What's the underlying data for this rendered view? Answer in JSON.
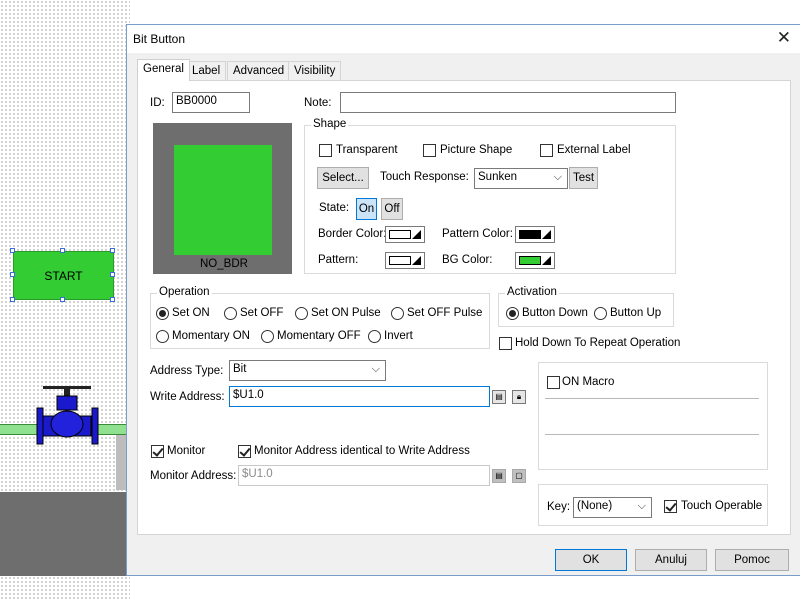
{
  "background": {
    "start_button_label": "START"
  },
  "dialog": {
    "title": "Bit Button",
    "close_glyph": "✕",
    "tabs": [
      "General",
      "Label",
      "Advanced",
      "Visibility"
    ],
    "id_label": "ID:",
    "id_value": "BB0000",
    "note_label": "Note:",
    "note_value": "",
    "preview_caption": "NO_BDR",
    "preview_color": "#33cc33",
    "shape": {
      "title": "Shape",
      "transparent": "Transparent",
      "picture_shape": "Picture Shape",
      "external_label": "External Label",
      "select_button": "Select...",
      "touch_response_label": "Touch Response:",
      "touch_response_value": "Sunken",
      "test_button": "Test",
      "state_label": "State:",
      "state_on": "On",
      "state_off": "Off",
      "border_color_label": "Border Color:",
      "pattern_color_label": "Pattern Color:",
      "pattern_label": "Pattern:",
      "bg_color_label": "BG Color:",
      "border_color": "#ffffff",
      "pattern_color": "#000000",
      "pattern": "#ffffff",
      "bg_color": "#33cc33"
    },
    "operation": {
      "title": "Operation",
      "set_on": "Set ON",
      "set_off": "Set OFF",
      "set_on_pulse": "Set ON Pulse",
      "set_off_pulse": "Set OFF Pulse",
      "momentary_on": "Momentary ON",
      "momentary_off": "Momentary OFF",
      "invert": "Invert",
      "selected": "Set ON"
    },
    "activation": {
      "title": "Activation",
      "button_down": "Button Down",
      "button_up": "Button Up",
      "selected": "Button Down"
    },
    "hold_down_label": "Hold Down To Repeat Operation",
    "address_type_label": "Address Type:",
    "address_type_value": "Bit",
    "write_address_label": "Write Address:",
    "write_address_value": "$U1.0",
    "on_macro_label": "ON Macro",
    "monitor_label": "Monitor",
    "monitor_identical_label": "Monitor Address identical to Write Address",
    "monitor_address_label": "Monitor Address:",
    "monitor_address_value": "$U1.0",
    "key_label": "Key:",
    "key_value": "(None)",
    "touch_operable_label": "Touch Operable",
    "ok_button": "OK",
    "cancel_button": "Anuluj",
    "help_button": "Pomoc"
  }
}
